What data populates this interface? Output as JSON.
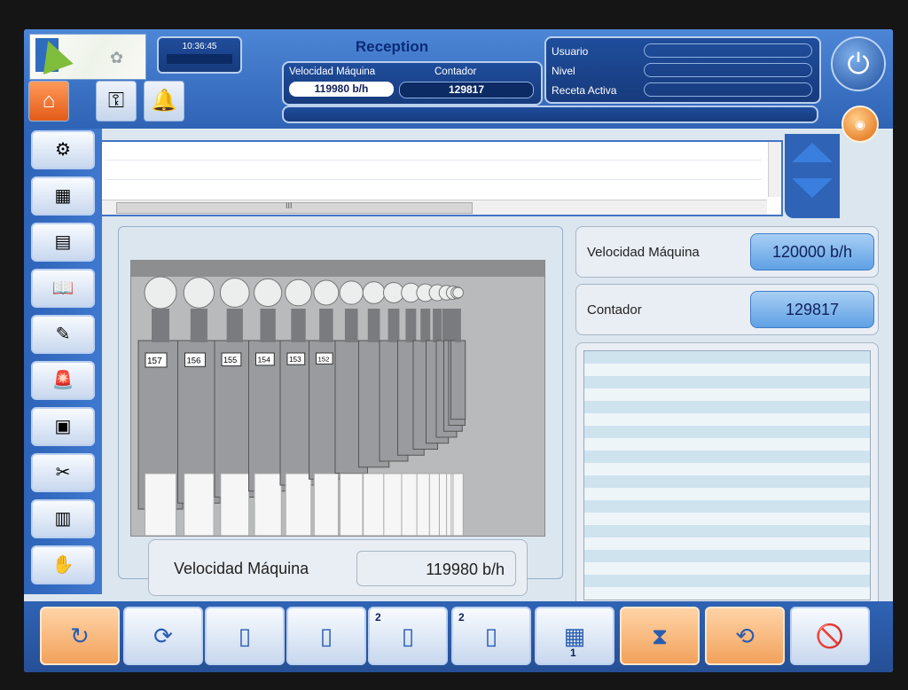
{
  "header": {
    "title": "Reception",
    "clock_time": "10:36:45",
    "clock_date": "",
    "speed_label": "Velocidad Máquina",
    "speed_value": "119980  b/h",
    "counter_label": "Contador",
    "counter_value": "129817",
    "info": {
      "user_label": "Usuario",
      "user_value": "",
      "level_label": "Nivel",
      "level_value": "",
      "recipe_label": "Receta Activa",
      "recipe_value": ""
    },
    "message": ""
  },
  "alarms": {
    "rows": [
      {
        "text": "",
        "source": "",
        "state": ""
      },
      {
        "text": "",
        "source": "",
        "state": ""
      }
    ],
    "scroll_mark": "III"
  },
  "top_icons": [
    {
      "name": "home",
      "icon": "⌂"
    },
    {
      "name": "key",
      "icon": "⚿"
    },
    {
      "name": "bell",
      "icon": "🔔"
    }
  ],
  "sidebar": [
    {
      "name": "machine-overview",
      "icon": "⚙"
    },
    {
      "name": "production-line",
      "icon": "▦"
    },
    {
      "name": "settings-panel",
      "icon": "▤"
    },
    {
      "name": "manual-book",
      "icon": "📖"
    },
    {
      "name": "reports",
      "icon": "✎"
    },
    {
      "name": "alarm-lamp",
      "icon": "🚨"
    },
    {
      "name": "calendar",
      "icon": "▣"
    },
    {
      "name": "tools",
      "icon": "✂"
    },
    {
      "name": "bottles",
      "icon": "▥"
    },
    {
      "name": "maintenance",
      "icon": "✋"
    }
  ],
  "right_panel": {
    "speed_label": "Velocidad Máquina",
    "speed_value": "120000 b/h",
    "counter_label": "Contador",
    "counter_value": "129817"
  },
  "image_caption": {
    "label": "Velocidad Máquina",
    "value": "119980  b/h"
  },
  "photo_labels": [
    "157",
    "156",
    "155",
    "154",
    "153",
    "152"
  ],
  "toolbar": [
    {
      "name": "refresh",
      "icon": "↻",
      "small": ""
    },
    {
      "name": "cycle",
      "icon": "⟳",
      "small": ""
    },
    {
      "name": "bottle-step",
      "icon": "▯",
      "small": ""
    },
    {
      "name": "bottle-step-b",
      "icon": "▯",
      "small": ""
    },
    {
      "name": "bottle-step-2",
      "icon": "▯",
      "small": "2"
    },
    {
      "name": "bottle-step-2b",
      "icon": "▯",
      "small": "2"
    },
    {
      "name": "multi-step",
      "icon": "▦",
      "small": "1"
    },
    {
      "name": "valve",
      "icon": "⧗",
      "small": ""
    },
    {
      "name": "cip",
      "icon": "⟲",
      "small": ""
    },
    {
      "name": "alarm-mute",
      "icon": "🚫",
      "small": ""
    }
  ],
  "colors": {
    "header_blue": "#2f63b5",
    "accent_orange": "#e35b19",
    "value_blue": "#5fa0e4"
  }
}
